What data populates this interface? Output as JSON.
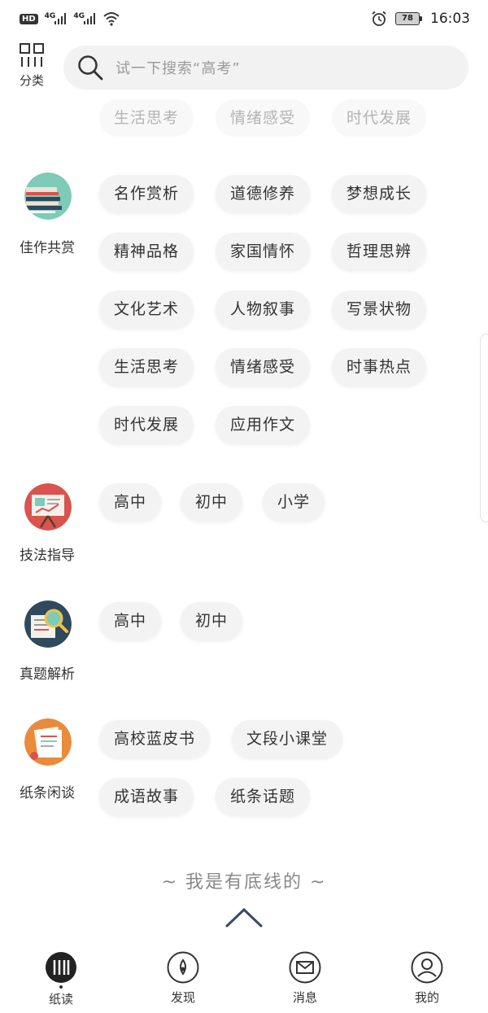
{
  "status_bar": {
    "hd": "HD",
    "net1": "4G",
    "net2": "4G",
    "battery": "78",
    "time": "16:03"
  },
  "header": {
    "category_label": "分类",
    "search_placeholder": "试一下搜索“高考”"
  },
  "top_partial_chips": [
    "生活思考",
    "情绪感受",
    "时代发展"
  ],
  "sections": [
    {
      "label": "佳作共赏",
      "icon": "books-icon",
      "chips": [
        "名作赏析",
        "道德修养",
        "梦想成长",
        "精神品格",
        "家国情怀",
        "哲理思辨",
        "文化艺术",
        "人物叙事",
        "写景状物",
        "生活思考",
        "情绪感受",
        "时事热点",
        "时代发展",
        "应用作文"
      ]
    },
    {
      "label": "技法指导",
      "icon": "presentation-board-icon",
      "chips": [
        "高中",
        "初中",
        "小学"
      ]
    },
    {
      "label": "真题解析",
      "icon": "magnifier-document-icon",
      "chips": [
        "高中",
        "初中"
      ]
    },
    {
      "label": "纸条闲谈",
      "icon": "notes-icon",
      "chips": [
        "高校蓝皮书",
        "文段小课堂",
        "成语故事",
        "纸条话题"
      ]
    }
  ],
  "end_note": "~ 我是有底线的 ~",
  "bottom_nav": [
    {
      "label": "纸读",
      "icon": "read-icon",
      "active": true
    },
    {
      "label": "发现",
      "icon": "compass-icon",
      "active": false
    },
    {
      "label": "消息",
      "icon": "mail-icon",
      "active": false
    },
    {
      "label": "我的",
      "icon": "profile-icon",
      "active": false
    }
  ],
  "colors": {
    "chip_bg": "#f3f3f3",
    "accent_teal": "#7ecbb7",
    "accent_red": "#d9534f",
    "accent_navy": "#2f4a5e",
    "accent_orange": "#e98b3a"
  }
}
